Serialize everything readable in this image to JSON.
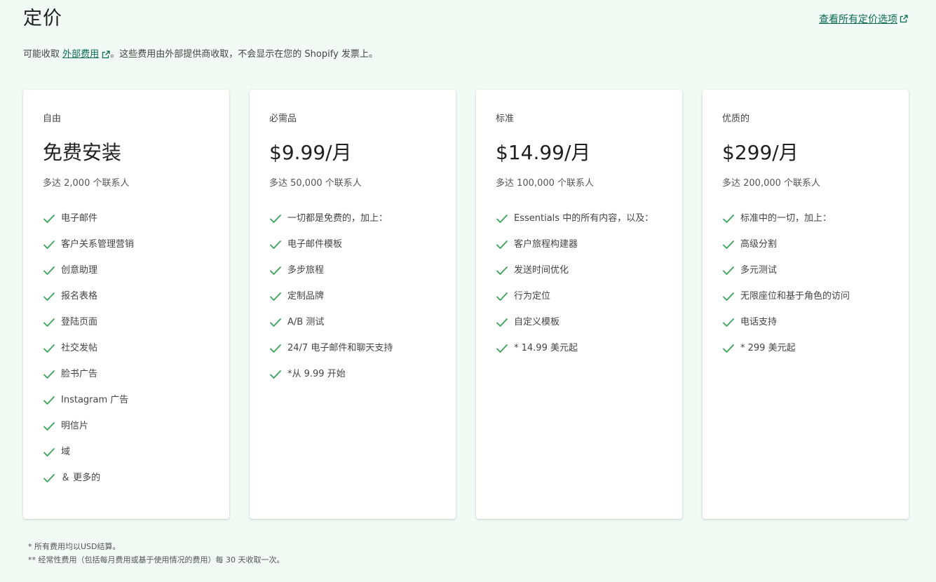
{
  "header": {
    "title": "定价",
    "all_pricing_link": "查看所有定价选项"
  },
  "subtitle": {
    "prefix": "可能收取 ",
    "link": "外部费用",
    "suffix": "。这些费用由外部提供商收取，不会显示在您的 Shopify 发票上。"
  },
  "colors": {
    "check": "#3ba35a",
    "link": "#0b6b53",
    "background": "#f1faf4"
  },
  "plans": [
    {
      "name": "自由",
      "price": "免费安装",
      "contacts": "多达 2,000 个联系人",
      "features": [
        "电子邮件",
        "客户关系管理营销",
        "创意助理",
        "报名表格",
        "登陆页面",
        "社交发帖",
        "脸书广告",
        "Instagram 广告",
        "明信片",
        "域",
        "＆ 更多的"
      ]
    },
    {
      "name": "必需品",
      "price": "$9.99/月",
      "contacts": "多达 50,000 个联系人",
      "features": [
        "一切都是免费的，加上：",
        "电子邮件模板",
        "多步旅程",
        "定制品牌",
        "A/B 测试",
        "24/7 电子邮件和聊天支持",
        "*从 9.99 开始"
      ]
    },
    {
      "name": "标准",
      "price": "$14.99/月",
      "contacts": "多达 100,000 个联系人",
      "features": [
        "Essentials 中的所有内容，以及：",
        "客户旅程构建器",
        "发送时间优化",
        "行为定位",
        "自定义模板",
        "* 14.99 美元起"
      ]
    },
    {
      "name": "优质的",
      "price": "$299/月",
      "contacts": "多达 200,000 个联系人",
      "features": [
        "标准中的一切，加上：",
        "高级分割",
        "多元测试",
        "无限座位和基于角色的访问",
        "电话支持",
        "* 299 美元起"
      ]
    }
  ],
  "footnotes": {
    "line1": "* 所有费用均以USD结算。",
    "line2": "** 经常性费用（包括每月费用或基于使用情况的费用）每 30 天收取一次。"
  }
}
